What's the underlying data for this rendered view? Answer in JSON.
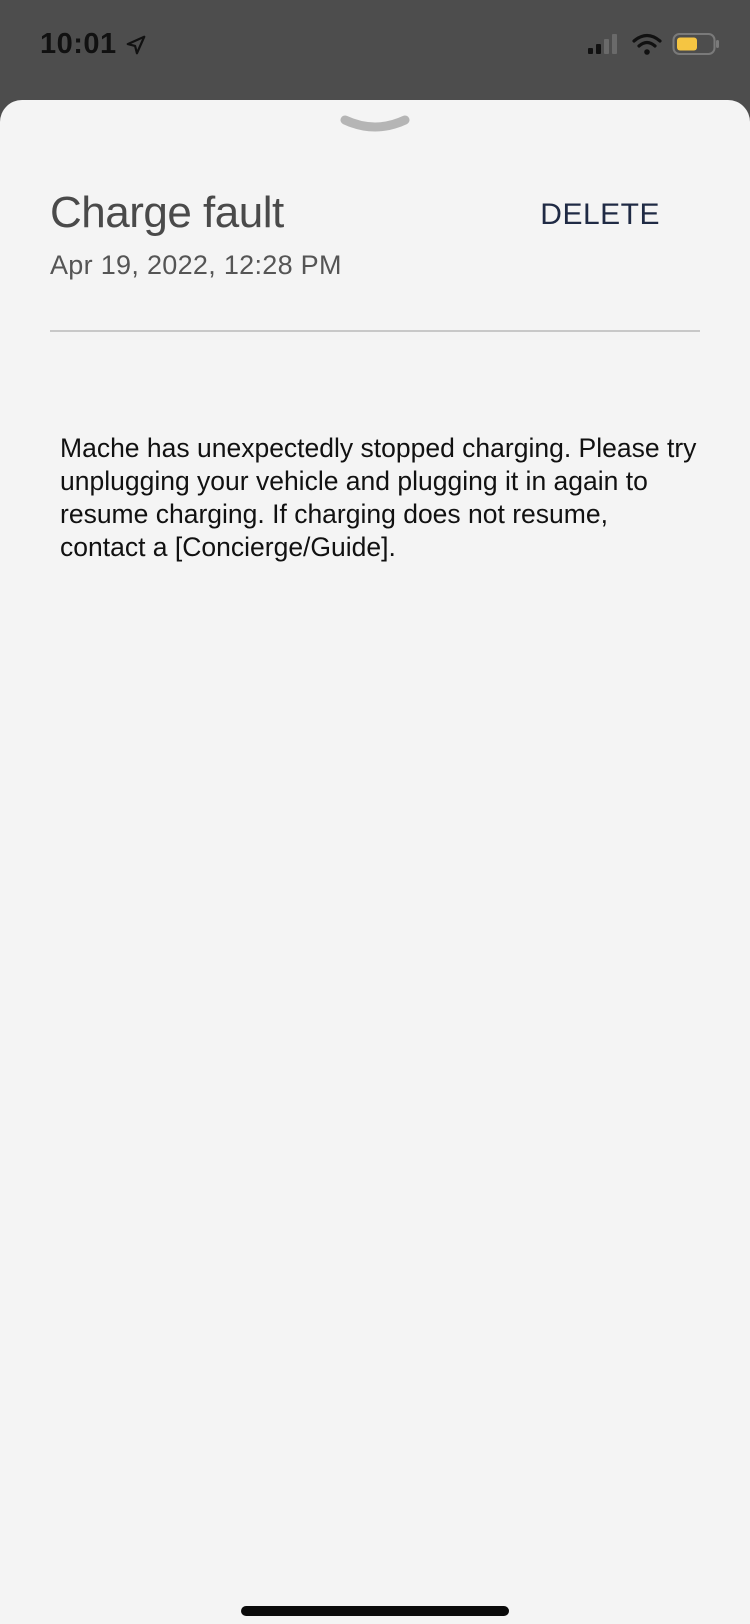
{
  "status_bar": {
    "time": "10:01"
  },
  "notification": {
    "title": "Charge fault",
    "timestamp": "Apr 19, 2022, 12:28 PM",
    "delete_label": "DELETE",
    "message": "Mache  has unexpectedly stopped charging. Please try unplugging your vehicle and plugging it in again to resume charging. If charging does not resume, contact a [Concierge/Guide]."
  },
  "icons": {
    "location": "location-arrow-icon",
    "signal": "cellular-signal-icon",
    "wifi": "wifi-icon",
    "battery": "battery-icon",
    "grabber": "chevron-down-icon"
  },
  "colors": {
    "status_bar_bg": "#4d4d4d",
    "sheet_bg": "#f4f4f4",
    "delete_text": "#1f2a44",
    "battery_fill": "#f5c542"
  }
}
